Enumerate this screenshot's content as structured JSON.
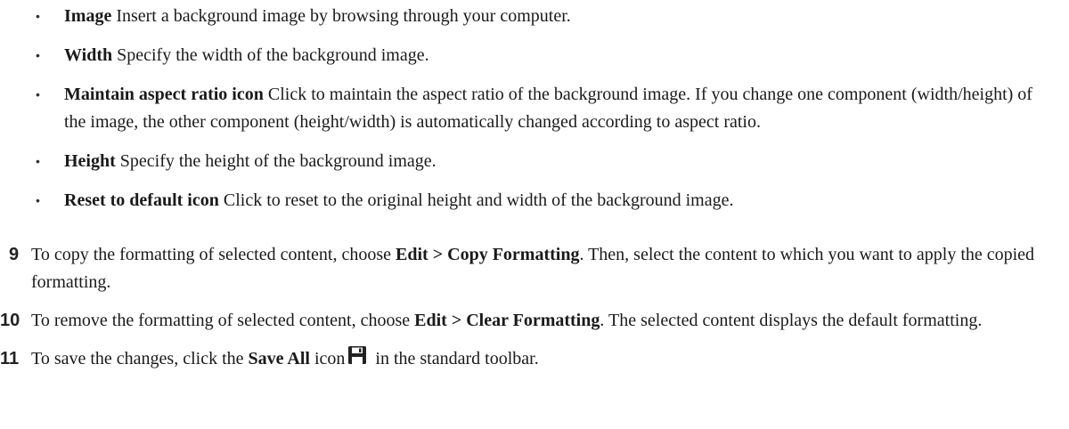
{
  "bullets": [
    {
      "term": "Image",
      "text": " Insert a background image by browsing through your computer."
    },
    {
      "term": "Width",
      "text": " Specify the width of the background image."
    },
    {
      "term": "Maintain aspect ratio icon",
      "text": " Click to maintain the aspect ratio of the background image. If you change one component (width/height) of the image, the other component (height/width) is automatically changed according to aspect ratio."
    },
    {
      "term": "Height",
      "text": " Specify the height of the background image."
    },
    {
      "term": "Reset to default icon",
      "text": " Click to reset to the original height and width of the background image."
    }
  ],
  "steps": [
    {
      "number": "9",
      "pre": "To copy the formatting of selected content, choose ",
      "menu": "Edit",
      "separator": " > ",
      "command": "Copy Formatting",
      "post": ". Then, select the content to which you want to apply the copied formatting."
    },
    {
      "number": "10",
      "pre": "To remove the formatting of selected content, choose ",
      "menu": "Edit",
      "separator": " > ",
      "command": "Clear Formatting",
      "post": ". The selected content displays the default formatting."
    },
    {
      "number": "11",
      "pre": "To save the changes, click the ",
      "command": "Save All",
      "mid": " icon",
      "post": " in the standard toolbar.",
      "icon": "save-all-icon"
    }
  ],
  "colors": {
    "text": "#1a1a1a",
    "icon": "#222222"
  }
}
